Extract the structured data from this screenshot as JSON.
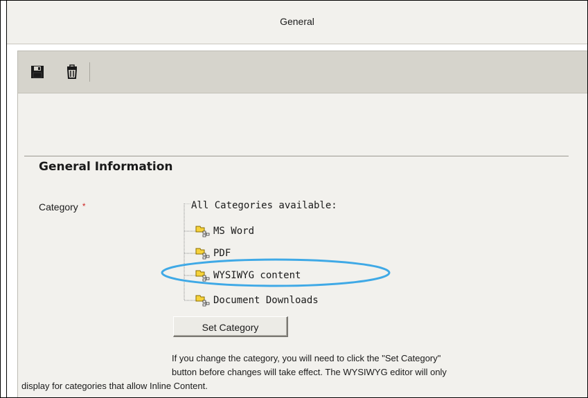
{
  "window": {
    "title": "General"
  },
  "toolbar": {
    "buttons": [
      {
        "icon": "floppy-disk-icon",
        "action": "save"
      },
      {
        "icon": "trash-can-icon",
        "action": "delete"
      }
    ]
  },
  "section": {
    "heading": "General Information"
  },
  "category_field": {
    "label": "Category",
    "required_marker": "*",
    "required_color": "#cc2222"
  },
  "category_tree": {
    "root_label": "All Categories available:",
    "items": [
      {
        "label": "MS Word",
        "icon": "category-folder-icon"
      },
      {
        "label": "PDF",
        "icon": "category-folder-icon"
      },
      {
        "label": "WYSIWYG content",
        "icon": "category-folder-icon",
        "highlighted": true
      },
      {
        "label": "Document Downloads",
        "icon": "category-folder-icon"
      }
    ],
    "highlight_color": "#3fa9e6"
  },
  "set_category_button": {
    "label": "Set Category"
  },
  "help": {
    "line1": "If you change the category, you will need to click the \"Set Category\"",
    "line2": "button before changes will take effect. The WYSIWYG editor will only",
    "line3": "display for categories that allow Inline Content."
  }
}
